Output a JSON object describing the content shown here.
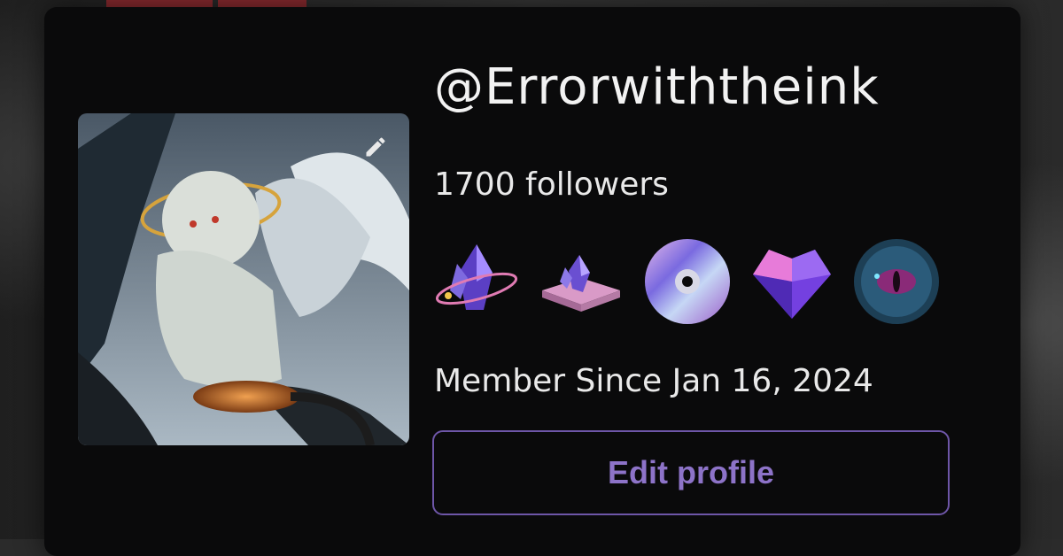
{
  "profile": {
    "username": "@Errorwiththeink",
    "followers": "1700 followers",
    "member_since": "Member Since Jan 16, 2024",
    "edit_button_label": "Edit profile"
  },
  "badges": [
    {
      "icon": "crystal-orbit-icon"
    },
    {
      "icon": "crystal-book-icon"
    },
    {
      "icon": "holographic-disc-icon"
    },
    {
      "icon": "gem-heart-icon"
    },
    {
      "icon": "eye-orb-icon"
    }
  ],
  "colors": {
    "card_bg": "#0a0a0b",
    "accent": "#8d73c8",
    "accent_border": "#6e56a8",
    "text": "#e9e9e9"
  }
}
